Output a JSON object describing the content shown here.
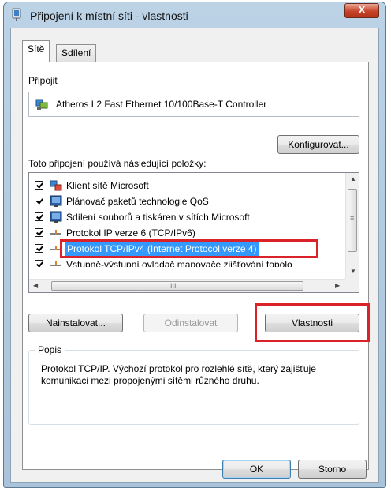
{
  "window": {
    "title": "Připojení k místní síti - vlastnosti",
    "close_label": "X"
  },
  "tabs": [
    {
      "label": "Sítě",
      "active": true
    },
    {
      "label": "Sdílení",
      "active": false
    }
  ],
  "connect": {
    "label": "Připojit",
    "adapter_name": "Atheros L2 Fast Ethernet 10/100Base-T Controller",
    "configure_button": "Konfigurovat..."
  },
  "items": {
    "label": "Toto připojení používá následující položky:",
    "list": [
      {
        "label": "Klient sítě Microsoft",
        "checked": true,
        "icon": "network-client-icon"
      },
      {
        "label": "Plánovač paketů technologie QoS",
        "checked": true,
        "icon": "service-icon"
      },
      {
        "label": "Sdílení souborů a tiskáren v sítích Microsoft",
        "checked": true,
        "icon": "service-icon"
      },
      {
        "label": "Protokol IP verze 6 (TCP/IPv6)",
        "checked": true,
        "icon": "protocol-icon"
      },
      {
        "label": "Protokol TCP/IPv4 (Internet Protocol verze 4)",
        "checked": true,
        "icon": "protocol-icon",
        "selected": true
      },
      {
        "label": "Vstupně-výstupní ovladač mapovače zjišťování topolo",
        "checked": true,
        "icon": "protocol-icon"
      }
    ],
    "scroll_grip": "III"
  },
  "actions": {
    "install": "Nainstalovat...",
    "uninstall": "Odinstalovat",
    "properties": "Vlastnosti"
  },
  "description": {
    "legend": "Popis",
    "text": "Protokol TCP/IP. Výchozí protokol pro rozlehlé sítě, který zajišťuje komunikaci mezi propojenými sítěmi různého druhu."
  },
  "footer": {
    "ok": "OK",
    "cancel": "Storno"
  },
  "colors": {
    "selection": "#3399ff",
    "highlight_outline": "#d9222a",
    "close_button": "#c7442a"
  }
}
